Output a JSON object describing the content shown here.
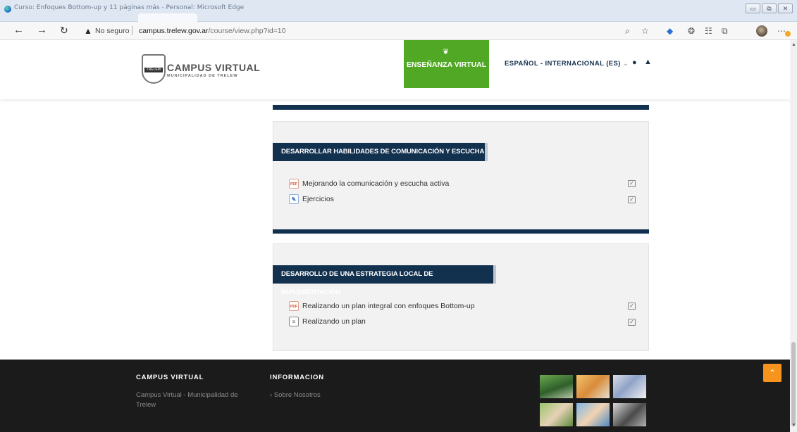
{
  "browser": {
    "window_title": "Curso: Enfoques Bottom-up y 11 páginas más - Personal: Microsoft Edge",
    "insecure_label": "No seguro",
    "url_host": "campus.trelew.gov.ar",
    "url_path": "/course/view.php?id=10",
    "window_buttons": [
      "▭",
      "⧉",
      "✕"
    ]
  },
  "header": {
    "logo_title": "CAMPUS VIRTUAL",
    "logo_subtitle": "MUNICIPALIDAD DE TRELEW",
    "logo_badge": "TRELEW",
    "green_button": "ENSEÑANZA VIRTUAL",
    "language": "ESPAÑOL - INTERNACIONAL (ES)",
    "language_caret": "⌄"
  },
  "sections": [
    {
      "title": "DESARROLLAR HABILIDADES DE COMUNICACIÓN Y ESCUCHA",
      "activities": [
        {
          "icon": "pdf-icon",
          "glyph": "PDF",
          "label": "Mejorando la comunicación y escucha activa"
        },
        {
          "icon": "quiz-icon",
          "glyph": "✎",
          "label": "Ejercicios"
        }
      ]
    },
    {
      "title": "DESARROLLO DE UNA ESTRATEGIA LOCAL DE IMPLEMENTACIÓN",
      "activities": [
        {
          "icon": "pdf-icon",
          "glyph": "PDF",
          "label": "Realizando un plan integral con enfoques Bottom-up"
        },
        {
          "icon": "page-icon",
          "glyph": "≡",
          "label": "Realizando un plan"
        }
      ]
    }
  ],
  "footer": {
    "col1_title": "CAMPUS VIRTUAL",
    "col1_text": "Campus Virtual - Municipalidad de Trelew",
    "col2_title": "INFORMACION",
    "col2_link": "› Sobre Nosotros"
  },
  "colors": {
    "navy": "#12314f",
    "green": "#51a824",
    "orange": "#f7941d",
    "footer_bg": "#1b1b1b"
  }
}
